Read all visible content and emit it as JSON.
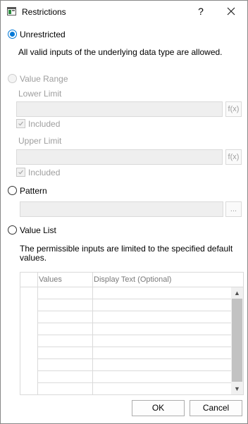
{
  "window": {
    "title": "Restrictions",
    "help_label": "?"
  },
  "options": {
    "unrestricted": {
      "label": "Unrestricted",
      "description": "All valid inputs of the underlying data type are allowed.",
      "selected": true
    },
    "value_range": {
      "label": "Value Range",
      "lower_limit_label": "Lower Limit",
      "lower_limit_value": "",
      "lower_included_label": "Included",
      "upper_limit_label": "Upper Limit",
      "upper_limit_value": "",
      "upper_included_label": "Included",
      "function_button_label": "f(x)"
    },
    "pattern": {
      "label": "Pattern",
      "value": "",
      "browse_label": "..."
    },
    "value_list": {
      "label": "Value List",
      "description_line1": "The permissible inputs are limited to the specified default",
      "description_line2": "values.",
      "columns": [
        "Values",
        "Display Text (Optional)"
      ]
    }
  },
  "buttons": {
    "ok": "OK",
    "cancel": "Cancel"
  },
  "colors": {
    "accent": "#0078d7",
    "disabled_text": "#9e9e9e",
    "disabled_field": "#efefef"
  },
  "icons": {
    "app": "table-window-icon",
    "close": "close-icon",
    "scroll_up": "chevron-up-icon",
    "scroll_down": "chevron-down-icon"
  }
}
